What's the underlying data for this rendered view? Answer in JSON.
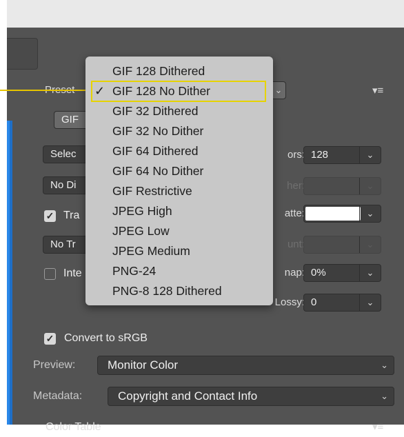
{
  "colors": {
    "panel": "#535353",
    "dropdown": "#c8c8c8",
    "highlight": "#e6d300",
    "accent_blue": "#2a87e8"
  },
  "preset": {
    "label": "Preset",
    "menu_icon": "panel-menu-icon",
    "options": [
      "GIF 128 Dithered",
      "GIF 128 No Dither",
      "GIF 32 Dithered",
      "GIF 32 No Dither",
      "GIF 64 Dithered",
      "GIF 64 No Dither",
      "GIF Restrictive",
      "JPEG High",
      "JPEG Low",
      "JPEG Medium",
      "PNG-24",
      "PNG-8 128 Dithered"
    ],
    "selected": "GIF 128 No Dither",
    "check": "✓"
  },
  "left_controls": {
    "format": "GIF",
    "reduction": "Selec",
    "dither": "No Di",
    "transparency_label": "Tra",
    "transparency_dither": "No Tr",
    "interlaced_label": "Inte"
  },
  "right_controls": {
    "colors_label": "ors:",
    "colors_value": "128",
    "dither_label": "her:",
    "matte_label": "atte:",
    "amount_label": "unt:",
    "web_snap_label": "nap:",
    "web_snap_value": "0%",
    "lossy_label": "Lossy:",
    "lossy_value": "0"
  },
  "convert": {
    "label": "Convert to sRGB",
    "checked": true
  },
  "preview": {
    "label": "Preview:",
    "value": "Monitor Color"
  },
  "metadata": {
    "label": "Metadata:",
    "value": "Copyright and Contact Info"
  },
  "color_table": {
    "label": "Color Table"
  }
}
